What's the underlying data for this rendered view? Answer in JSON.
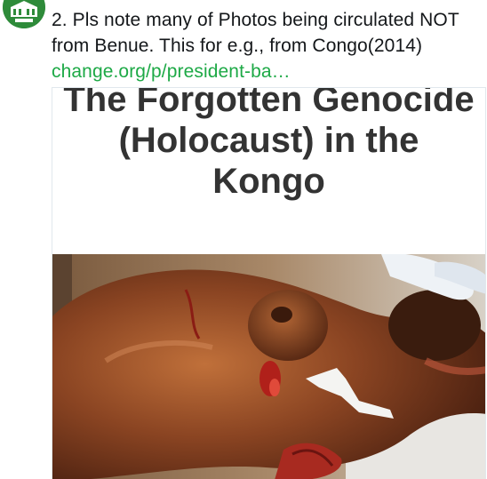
{
  "tweet": {
    "text": "2. Pls note many of Photos being circulated NOT from Benue. This for e.g., from Congo(2014)",
    "link_text": "change.org/p/president-ba…",
    "link_color": "#1da946",
    "avatar_icon": "account-avatar-icon"
  },
  "media": {
    "heading": "The Forgotten Genocide\n(Holocaust) in the\nKongo",
    "photo_icon": "photo-image"
  }
}
